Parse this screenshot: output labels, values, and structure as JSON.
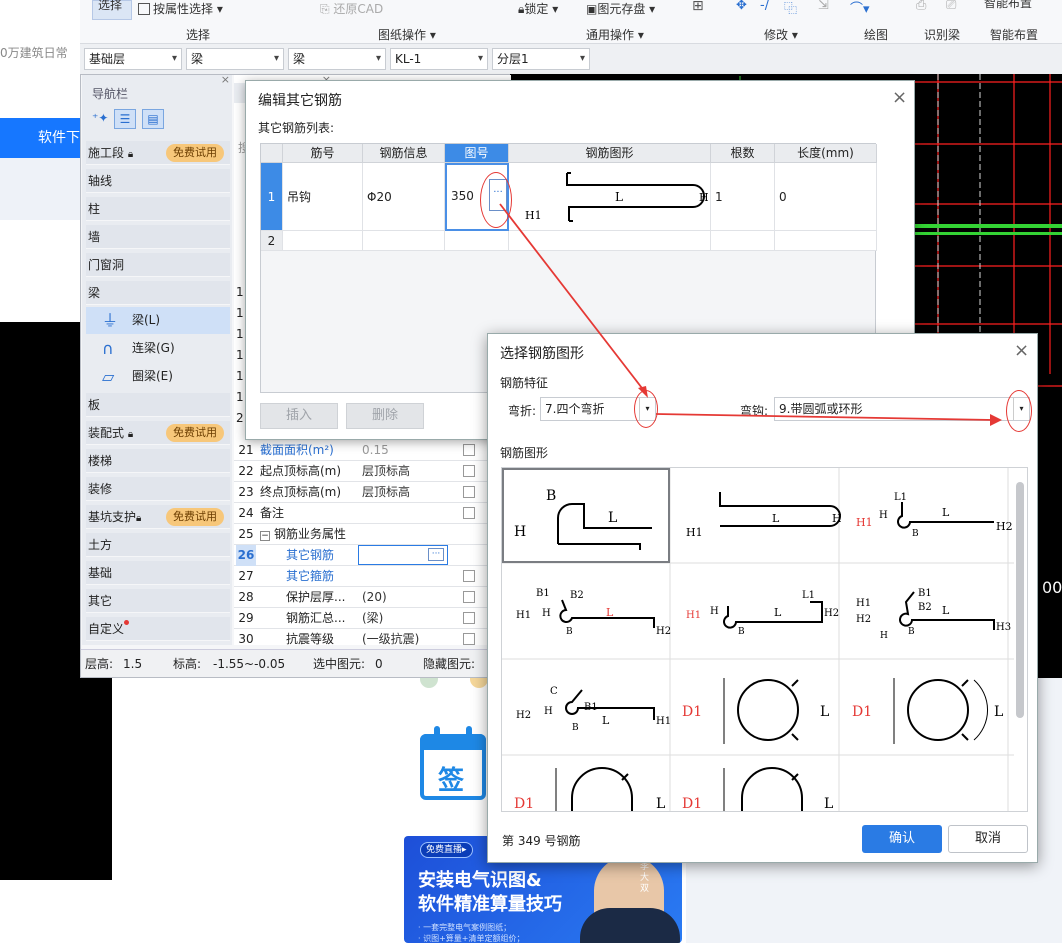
{
  "web": {
    "partial_text": "0万建筑日常",
    "nav_item": "软件下",
    "promo_tag": "免费直播▸",
    "promo_line1": "安装电气识图&",
    "promo_line2": "软件精准算量技巧",
    "promo_notes": [
      "· 一套完整电气案例图纸；",
      "· 识图+算量+清单定额组价；"
    ],
    "sign_label": "签",
    "teacher_caption": "李大双"
  },
  "ribbon": {
    "select_btn": "选择",
    "by_attr": "按属性选择",
    "restore_cad": "还原CAD",
    "lock": "锁定",
    "save_element": "图元存盘",
    "smart_layout": "智能布置",
    "groups": [
      "选择",
      "图纸操作",
      "通用操作",
      "修改",
      "绘图",
      "识别梁",
      "智能布置"
    ]
  },
  "toolbar": {
    "floor": "基础层",
    "category": "梁",
    "type": "梁",
    "element": "KL-1",
    "sublayer": "分层1"
  },
  "cad": {
    "right_text": "00"
  },
  "nav": {
    "title": "导航栏",
    "items": [
      {
        "label": "施工段",
        "badge": "免费试用"
      },
      {
        "label": "轴线"
      },
      {
        "label": "柱"
      },
      {
        "label": "墙"
      },
      {
        "label": "门窗洞"
      },
      {
        "label": "梁"
      },
      {
        "label": "板"
      },
      {
        "label": "装配式",
        "badge": "免费试用"
      },
      {
        "label": "楼梯"
      },
      {
        "label": "装修"
      },
      {
        "label": "基坑支护",
        "badge": "免费试用"
      },
      {
        "label": "土方"
      },
      {
        "label": "基础"
      },
      {
        "label": "其它"
      },
      {
        "label": "自定义"
      }
    ],
    "sub_items": [
      "梁(L)",
      "连梁(G)",
      "圈梁(E)"
    ]
  },
  "props": {
    "search_hint": "搜",
    "rows": [
      {
        "n": "21",
        "k": "截面面积(m²)",
        "v": "0.15"
      },
      {
        "n": "22",
        "k": "起点顶标高(m)",
        "v": "层顶标高"
      },
      {
        "n": "23",
        "k": "终点顶标高(m)",
        "v": "层顶标高"
      },
      {
        "n": "24",
        "k": "备注",
        "v": ""
      },
      {
        "n": "25",
        "k": "钢筋业务属性",
        "v": ""
      },
      {
        "n": "26",
        "k": "其它钢筋",
        "v": ""
      },
      {
        "n": "27",
        "k": "其它箍筋",
        "v": ""
      },
      {
        "n": "28",
        "k": "保护层厚...",
        "v": "(20)"
      },
      {
        "n": "29",
        "k": "钢筋汇总...",
        "v": "(梁)"
      },
      {
        "n": "30",
        "k": "抗震等级",
        "v": "(一级抗震)"
      }
    ],
    "left_nums": [
      "1",
      "1",
      "1",
      "1",
      "1",
      "1",
      "2"
    ]
  },
  "status": {
    "floor_height_label": "层高:",
    "floor_height": "1.5",
    "elev_label": "标高:",
    "elev": "-1.55~-0.05",
    "selected_label": "选中图元:",
    "selected": "0",
    "hidden_label": "隐藏图元:",
    "hidden": "0"
  },
  "dlg1": {
    "title": "编辑其它钢筋",
    "list_label": "其它钢筋列表:",
    "headers": [
      "筋号",
      "钢筋信息",
      "图号",
      "钢筋图形",
      "根数",
      "长度(mm)"
    ],
    "rows": [
      {
        "idx": "1",
        "name": "吊钩",
        "info": "Φ20",
        "fig": "350",
        "count": "1",
        "length": "0"
      },
      {
        "idx": "2",
        "name": "",
        "info": "",
        "fig": "",
        "count": "",
        "length": ""
      }
    ],
    "insert_btn": "插入",
    "delete_btn": "删除",
    "ellipsis": "···"
  },
  "dlg2": {
    "title": "选择钢筋图形",
    "feature_label": "钢筋特征",
    "bend_label": "弯折:",
    "bend_value": "7.四个弯折",
    "hook_label": "弯钩:",
    "hook_value": "9.带圆弧或环形",
    "shapes_label": "钢筋图形",
    "footer": "第 349 号钢筋",
    "ok": "确认",
    "cancel": "取消"
  },
  "colors": {
    "accent": "#2a7be4",
    "annotation": "#e53935",
    "badge": "#f7c77a"
  }
}
